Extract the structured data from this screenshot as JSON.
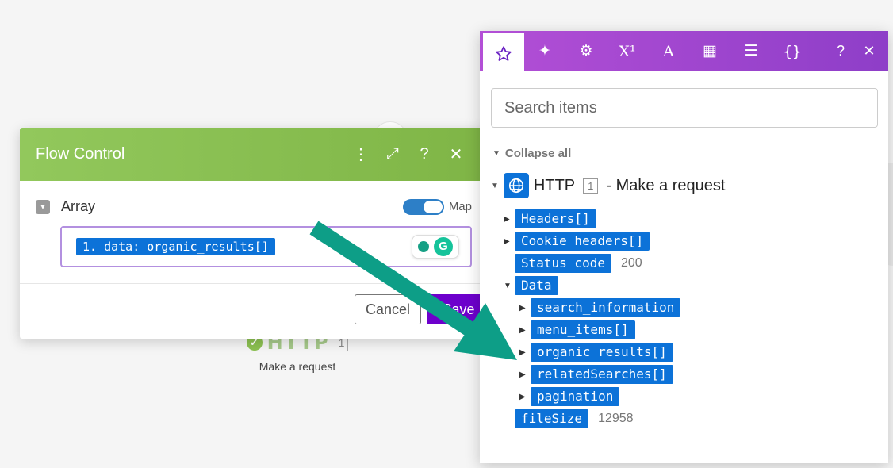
{
  "canvas": {
    "module": {
      "name": "HTTP",
      "number": "1",
      "label": "Make a request"
    }
  },
  "flow_control": {
    "title": "Flow Control",
    "field_label": "Array",
    "map_label": "Map",
    "value_pill": "1. data: organic_results[]",
    "cancel_label": "Cancel",
    "save_label": "Save"
  },
  "mapping_panel": {
    "search_placeholder": "Search items",
    "collapse_all_label": "Collapse all",
    "module": {
      "name": "HTTP",
      "number": "1",
      "action": "- Make a request"
    },
    "items": {
      "headers": "Headers[]",
      "cookie_headers": "Cookie headers[]",
      "status_code": "Status code",
      "status_code_value": "200",
      "data": "Data",
      "search_information": "search_information",
      "menu_items": "menu_items[]",
      "organic_results": "organic_results[]",
      "related_searches": "relatedSearches[]",
      "pagination": "pagination",
      "file_size": "fileSize",
      "file_size_value": "12958"
    }
  },
  "colors": {
    "header_green": "#8cc152",
    "panel_purple": "#9b46cf",
    "tag_blue": "#0c72d8",
    "arrow_teal": "#0d9e87"
  }
}
